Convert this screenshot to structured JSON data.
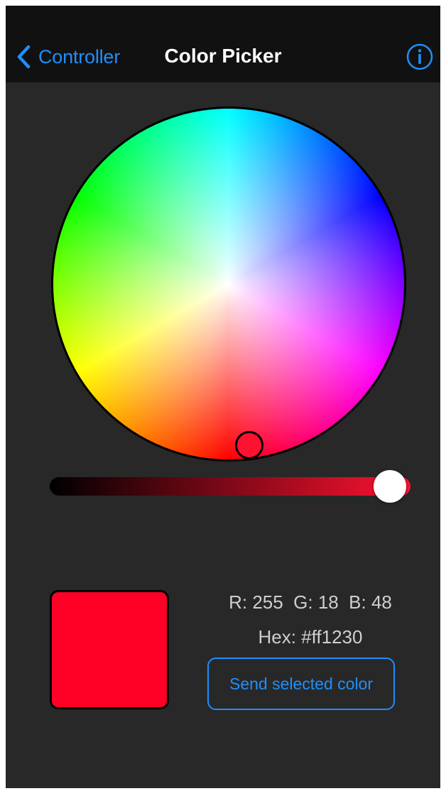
{
  "navbar": {
    "back_label": "Controller",
    "title": "Color Picker",
    "back_icon": "chevron-left-icon",
    "info_icon": "info-icon",
    "accent_color": "#1f8fff"
  },
  "picker": {
    "selected_color": "#ff1230",
    "brightness_fraction": 1.0,
    "brightness_gradient": [
      "#000000",
      "#ff1230"
    ]
  },
  "readout": {
    "rgb_text": "R: 255  G: 18  B: 48",
    "hex_text": "Hex: #ff1230"
  },
  "actions": {
    "send_label": "Send selected color"
  }
}
